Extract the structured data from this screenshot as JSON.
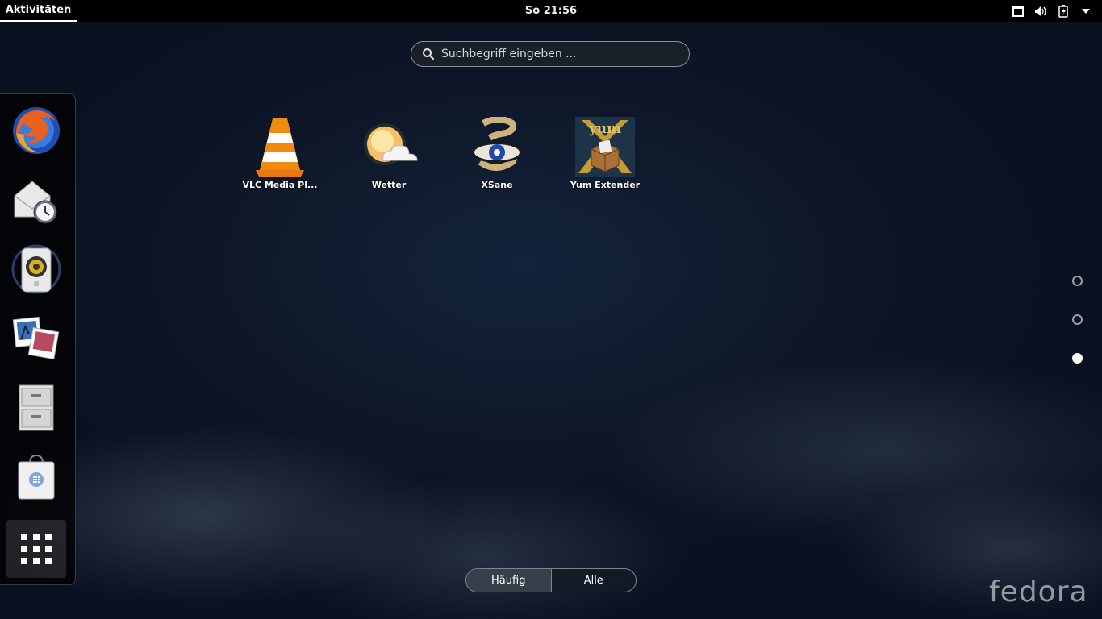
{
  "topbar": {
    "activities_label": "Aktivitäten",
    "clock": "So 21:56",
    "tray": [
      "window-icon",
      "volume-icon",
      "battery-icon",
      "menu-arrow-icon"
    ]
  },
  "search": {
    "placeholder": "Suchbegriff eingeben ..."
  },
  "dash": {
    "items": [
      {
        "name": "firefox-icon"
      },
      {
        "name": "evolution-mail-icon"
      },
      {
        "name": "rhythmbox-speaker-icon"
      },
      {
        "name": "shotwell-photos-icon"
      },
      {
        "name": "files-cabinet-icon"
      },
      {
        "name": "software-bag-icon"
      }
    ],
    "show_apps": "grid-icon"
  },
  "apps": [
    {
      "label": "VLC Media Pl...",
      "icon": "vlc-cone-icon"
    },
    {
      "label": "Wetter",
      "icon": "weather-icon"
    },
    {
      "label": "XSane",
      "icon": "xsane-eye-icon"
    },
    {
      "label": "Yum Extender",
      "icon": "yum-extender-icon"
    }
  ],
  "pages": {
    "count": 3,
    "active": 3
  },
  "view_switch": {
    "frequent": "Häufig",
    "all": "Alle",
    "selected": "Häufig"
  },
  "watermark": "fedora",
  "colors": {
    "topbar": "#000000",
    "accent": "#ffffff",
    "background": "#0d1627"
  }
}
